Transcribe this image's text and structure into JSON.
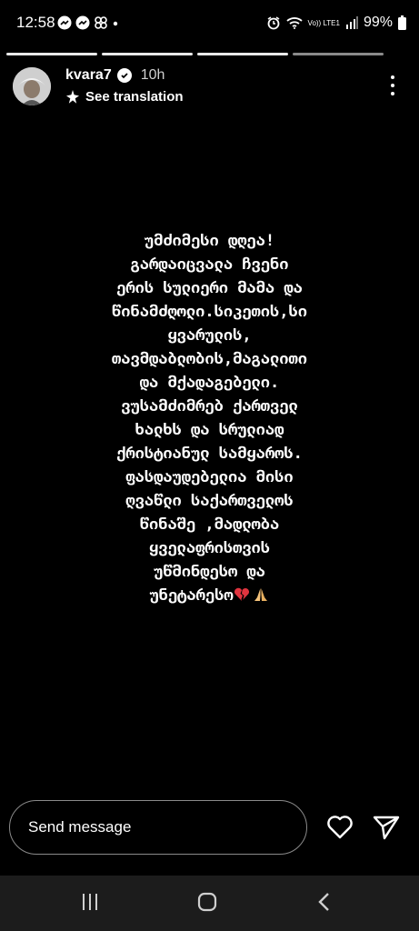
{
  "status_bar": {
    "time": "12:58",
    "network_label": "Vo)) LTE1",
    "battery": "99%"
  },
  "story": {
    "progress": {
      "total_segments": 4,
      "current_segment": 3
    },
    "user": {
      "username": "kvara7",
      "age": "10h",
      "verified": true
    },
    "translate_label": "See translation",
    "text": "უმძიმესი დღეა!\nგარდაიცვალა ჩვენი\nერის სულიერი  მამა და\nწინამძღოლი.სიკეთის,სი\nყვარულის,\nთავმდაბლობის,მაგალითი\nდა მქადაგებელი.\nვუსამძიმრებ ქართველ\nხალხს და სრულიად\nქრისტიანულ სამყაროს.\nფასდაუდებელია მისი\nღვაწლი საქართველოს\nწინაშე ,მადლობა\nყველაფრისთვის\nუწმინდესო და\nუნეტარესო",
    "emojis": [
      "broken-heart",
      "praying-hands"
    ]
  },
  "reply": {
    "placeholder": "Send message",
    "like_icon": "heart-icon",
    "share_icon": "send-icon"
  },
  "nav": {
    "recents_icon": "recents-icon",
    "home_icon": "home-icon",
    "back_icon": "back-icon"
  },
  "colors": {
    "background": "#000000",
    "text": "#ffffff",
    "nav_background": "#1c1c1c",
    "broken_heart": "#e0343f",
    "praying_hands": "#f4c27a"
  }
}
